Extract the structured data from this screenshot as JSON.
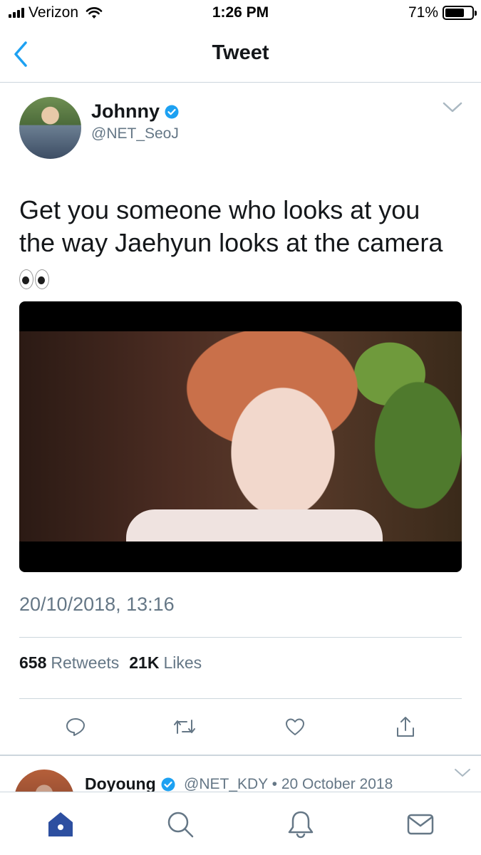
{
  "status_bar": {
    "carrier": "Verizon",
    "time": "1:26 PM",
    "battery_percent": "71%",
    "battery_level": 0.71
  },
  "nav": {
    "title": "Tweet",
    "back_icon": "chevron-left-icon"
  },
  "tweet": {
    "author_name": "Johnny",
    "author_handle": "@NET_SeoJ",
    "text_line1": "Get you someone who looks at you",
    "text_line2": "the way Jaehyun looks at the camera",
    "emoji": "eyes",
    "timestamp": "20/10/2018, 13:16",
    "retweets_count": "658",
    "retweets_label": "Retweets",
    "likes_count": "21K",
    "likes_label": "Likes",
    "actions": [
      "reply-icon",
      "retweet-icon",
      "like-icon",
      "share-icon"
    ]
  },
  "next_tweet": {
    "author_name": "Doyoung",
    "meta": "@NET_KDY • 20 October 2018"
  },
  "tab_bar": [
    "home-icon",
    "search-icon",
    "notifications-icon",
    "messages-icon"
  ],
  "colors": {
    "accent": "#1da1f2",
    "tab_active": "#2d4fa0",
    "secondary_text": "#657786",
    "border": "#ccd6dd"
  }
}
